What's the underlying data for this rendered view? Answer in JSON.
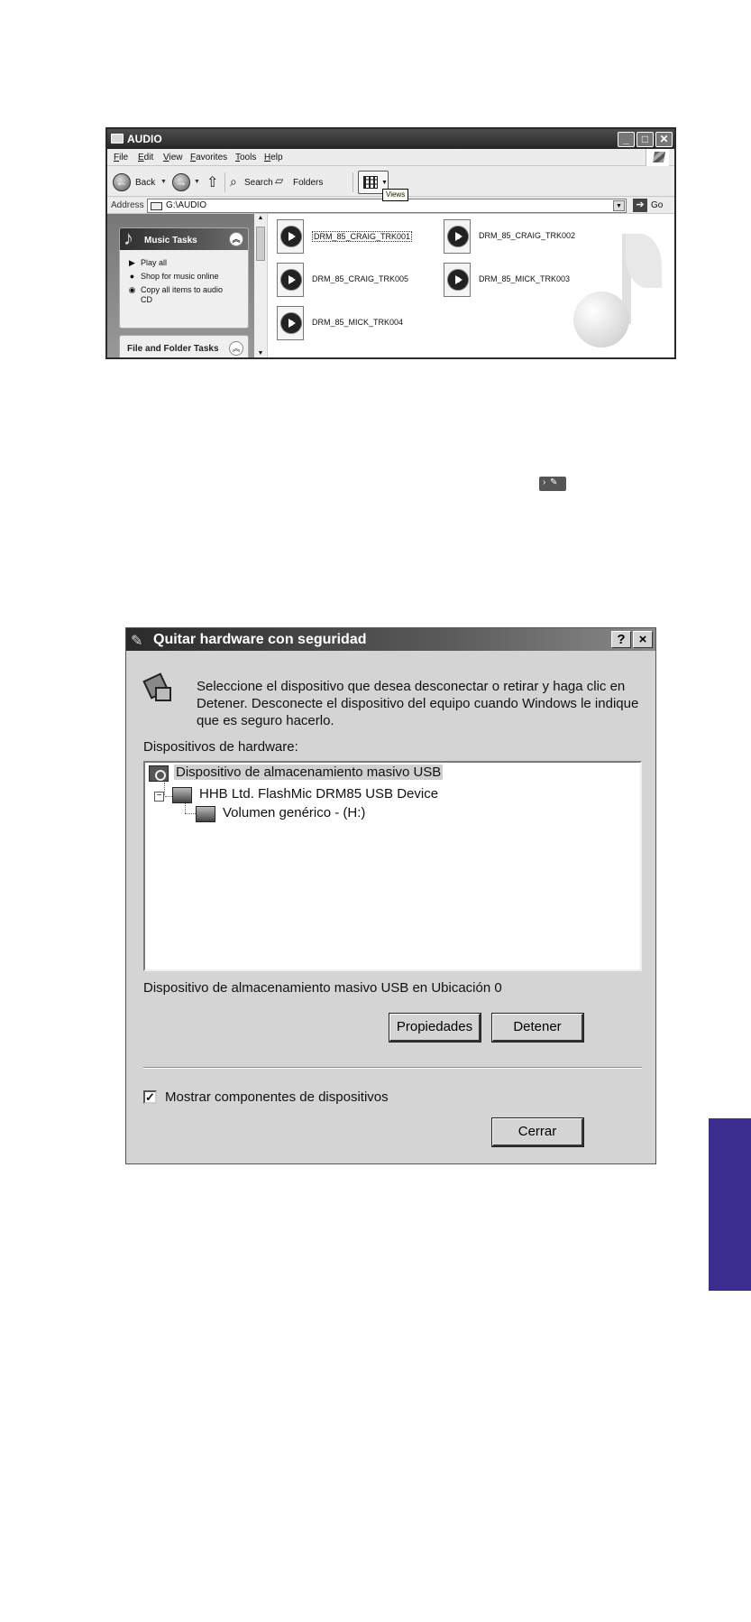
{
  "explorer": {
    "title": "AUDIO",
    "menu": [
      "File",
      "Edit",
      "View",
      "Favorites",
      "Tools",
      "Help"
    ],
    "toolbar": {
      "back": "Back",
      "search": "Search",
      "folders": "Folders",
      "views_tooltip": "Views"
    },
    "address": {
      "label": "Address",
      "value": "G:\\AUDIO",
      "go": "Go"
    },
    "music_tasks": {
      "title": "Music Tasks",
      "items": [
        "Play all",
        "Shop for music online",
        "Copy all items to audio",
        "CD"
      ]
    },
    "file_folder_tasks": "File and Folder Tasks",
    "files": [
      "DRM_85_CRAIG_TRK001",
      "DRM_85_CRAIG_TRK002",
      "DRM_85_CRAIG_TRK005",
      "DRM_85_MICK_TRK003",
      "DRM_85_MICK_TRK004"
    ]
  },
  "dialog": {
    "title": "Quitar hardware con seguridad",
    "help_button": "?",
    "close_button": "×",
    "message": [
      "Seleccione el dispositivo que desea desconectar o retirar y haga clic en",
      "Detener. Desconecte el dispositivo del equipo cuando Windows le indique",
      "que es seguro hacerlo."
    ],
    "hardware_label": "Dispositivos de hardware:",
    "tree": [
      "Dispositivo de almacenamiento masivo USB",
      "HHB Ltd. FlashMic DRM85 USB Device",
      "Volumen genérico - (H:)"
    ],
    "status": "Dispositivo de almacenamiento masivo USB en Ubicación 0",
    "buttons": {
      "properties": "Propiedades",
      "stop": "Detener",
      "close": "Cerrar"
    },
    "checkbox": {
      "label": "Mostrar componentes de dispositivos",
      "checked": true,
      "mark": "✓"
    }
  },
  "colors": {
    "side_tab": "#3b2d8f",
    "title_bar": "#2a2a2a",
    "dialog_face": "#d4d4d4"
  },
  "icons": [
    "folder-icon",
    "back-icon",
    "forward-icon",
    "up-icon",
    "search-icon",
    "folders-icon",
    "views-icon",
    "go-icon",
    "music-note-icon",
    "play-icon",
    "globe-icon",
    "cd-icon",
    "audio-file-icon",
    "usb-icon",
    "drive-icon",
    "safely-remove-icon"
  ]
}
